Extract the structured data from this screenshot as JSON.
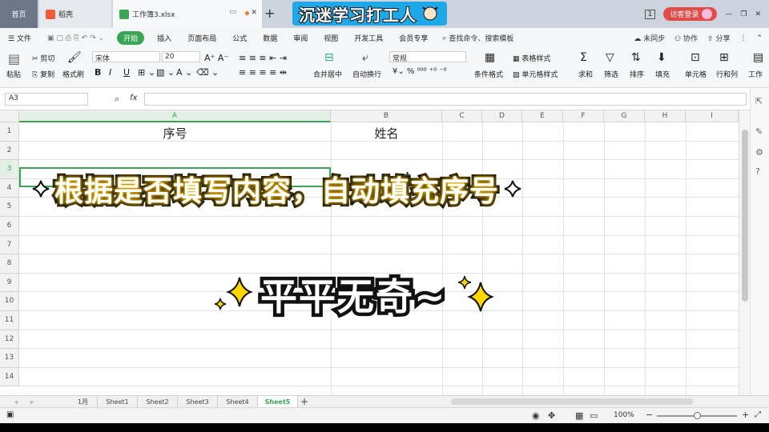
{
  "titlebar": {
    "home_tab": "首页",
    "docer_tab": "稻壳",
    "file_tab": "工作簿3.xlsx",
    "plus": "+",
    "banner_text": "沉迷学习打工人",
    "login_button": "访客登录",
    "count_badge": "1"
  },
  "menubar": {
    "file": "文件",
    "start": "开始",
    "items": [
      "插入",
      "页面布局",
      "公式",
      "数据",
      "审阅",
      "视图",
      "开发工具",
      "会员专享"
    ],
    "search": "查找命令、搜索模板",
    "sync": "未同步",
    "collab": "协作",
    "share": "分享"
  },
  "ribbon": {
    "paste": "粘贴",
    "cut": "剪切",
    "copy": "复制",
    "format_painter": "格式刷",
    "font_name": "宋体",
    "font_size": "20",
    "merge_center": "合并居中",
    "wrap_text": "自动换行",
    "number_format": "常规",
    "conditional_format": "条件格式",
    "table_style": "表格样式",
    "cell_style": "单元格样式",
    "sum": "求和",
    "filter": "筛选",
    "sort": "排序",
    "fill": "填充",
    "cell": "单元格",
    "row_col": "行和列",
    "worksheet": "工作"
  },
  "formula_bar": {
    "name_box": "A3",
    "fx": "fx",
    "formula": ""
  },
  "sheet": {
    "columns": [
      "A",
      "B",
      "C",
      "D",
      "E",
      "F",
      "G",
      "H",
      "I"
    ],
    "rows": [
      "1",
      "2",
      "3",
      "4",
      "5",
      "6",
      "7",
      "8",
      "9",
      "10",
      "11",
      "12",
      "13",
      "14"
    ],
    "a1": "序号",
    "b1": "姓名"
  },
  "overlay": {
    "caption": "根据是否填写内容，自动填充序号",
    "subcaption": "平平无奇~"
  },
  "sheet_tabs": [
    "1月",
    "Sheet1",
    "Sheet2",
    "Sheet3",
    "Sheet4",
    "Sheet5"
  ],
  "active_sheet": "Sheet5",
  "statusbar": {
    "zoom": "100%"
  },
  "colors": {
    "accent": "#3aa655",
    "banner": "#1ea8e8",
    "login": "#e34b4b",
    "glow": "#f5b800"
  }
}
